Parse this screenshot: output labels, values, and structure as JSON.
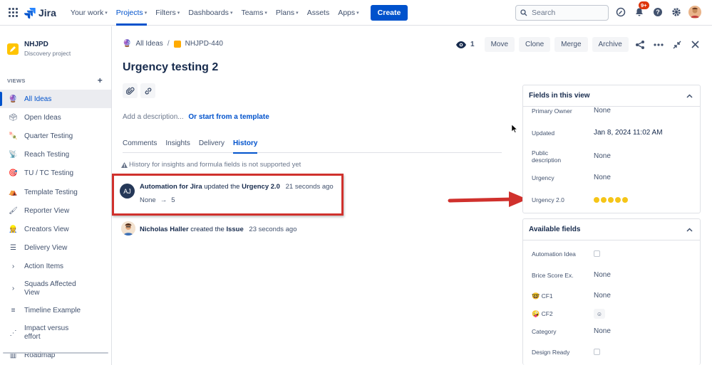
{
  "app": {
    "logo_text": "Jira"
  },
  "topnav": {
    "items": [
      {
        "label": "Your work",
        "caret": true
      },
      {
        "label": "Projects",
        "caret": true,
        "active": true
      },
      {
        "label": "Filters",
        "caret": true
      },
      {
        "label": "Dashboards",
        "caret": true
      },
      {
        "label": "Teams",
        "caret": true
      },
      {
        "label": "Plans",
        "caret": true
      },
      {
        "label": "Assets",
        "caret": false
      },
      {
        "label": "Apps",
        "caret": true
      }
    ],
    "create_label": "Create",
    "search_placeholder": "Search",
    "notification_badge": "9+"
  },
  "sidebar": {
    "project_name": "NHJPD",
    "project_type": "Discovery project",
    "views_header": "VIEWS",
    "items": [
      {
        "label": "All Ideas",
        "icon": "🔮",
        "active": true
      },
      {
        "label": "Open Ideas",
        "icon": "🗳"
      },
      {
        "label": "Quarter Testing",
        "icon": "🍡"
      },
      {
        "label": "Reach Testing",
        "icon": "📡"
      },
      {
        "label": "TU / TC Testing",
        "icon": "🎯"
      },
      {
        "label": "Template Testing",
        "icon": "⛺"
      },
      {
        "label": "Reporter View",
        "icon": "🖌"
      },
      {
        "label": "Creators View",
        "icon": "👷"
      },
      {
        "label": "Delivery View",
        "icon": "☰"
      },
      {
        "label": "Action Items",
        "icon": "›"
      },
      {
        "label": "Squads Affected View",
        "icon": "›"
      },
      {
        "label": "Timeline Example",
        "icon": "≡"
      },
      {
        "label": "Impact versus effort",
        "icon": "⋰"
      },
      {
        "label": "Roadmap",
        "icon": "▥"
      }
    ]
  },
  "breadcrumb": {
    "parent": "All Ideas",
    "issue_key": "NHJPD-440"
  },
  "issue": {
    "title": "Urgency testing 2",
    "description_placeholder": "Add a description...",
    "template_link": "Or start from a template"
  },
  "tabs": [
    "Comments",
    "Insights",
    "Delivery",
    "History"
  ],
  "history": {
    "note": "History for insights and formula fields is not supported yet",
    "entry1": {
      "avatar_initials": "AJ",
      "actor": "Automation for Jira",
      "verb": "updated the",
      "field": "Urgency 2.0",
      "time": "21 seconds ago",
      "from": "None",
      "arrow": "→",
      "to": "5"
    },
    "entry2": {
      "actor": "Nicholas Haller",
      "verb": "created the",
      "object": "Issue",
      "time": "23 seconds ago"
    }
  },
  "toolbar": {
    "watch_count": "1",
    "move": "Move",
    "clone": "Clone",
    "merge": "Merge",
    "archive": "Archive"
  },
  "fields_panel": {
    "title": "Fields in this view",
    "fields": [
      {
        "label": "Primary Owner",
        "value": "None"
      },
      {
        "label": "Updated",
        "value": "Jan 8, 2024 11:02 AM"
      },
      {
        "label": "Public description",
        "value": "None"
      },
      {
        "label": "Urgency",
        "value": "None"
      },
      {
        "label": "Urgency 2.0",
        "rating": 5
      }
    ]
  },
  "available_panel": {
    "title": "Available fields",
    "fields": [
      {
        "label": "Automation Idea",
        "type": "checkbox"
      },
      {
        "label": "Brice Score Ex.",
        "value": "None"
      },
      {
        "label": "CF1",
        "icon": "🤓",
        "value": "None"
      },
      {
        "label": "CF2",
        "icon": "🤪",
        "type": "emoji-button"
      },
      {
        "label": "Category",
        "value": "None"
      },
      {
        "label": "Design Ready",
        "type": "checkbox"
      }
    ]
  },
  "colors": {
    "primary": "#0052cc",
    "annotation": "#d0312d",
    "rating": "#f5c518"
  }
}
